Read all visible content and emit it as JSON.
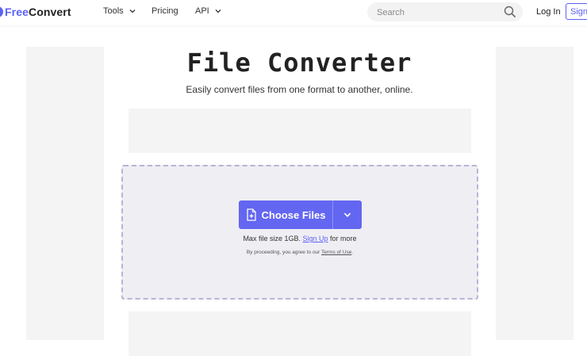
{
  "header": {
    "logo": {
      "part1": "Free",
      "part2": "Convert"
    },
    "nav": [
      {
        "label": "Tools",
        "has_dropdown": true
      },
      {
        "label": "Pricing",
        "has_dropdown": false
      },
      {
        "label": "API",
        "has_dropdown": true
      }
    ],
    "search": {
      "placeholder": "Search",
      "icon": "search-icon"
    },
    "login_label": "Log In",
    "signup_label": "Sign"
  },
  "main": {
    "title": "File Converter",
    "subtitle": "Easily convert files from one format to another, online.",
    "upload": {
      "button_label": "Choose Files",
      "button_icon": "file-plus-icon",
      "dropdown_icon": "chevron-down-icon",
      "max_size_prefix": "Max file size 1GB.",
      "signup_link": "Sign Up",
      "max_size_suffix": "for more",
      "terms_prefix": "By proceeding, you agree to our",
      "terms_link": "Terms of Use",
      "terms_suffix": "."
    }
  },
  "colors": {
    "accent": "#6366f1",
    "brand": "#5b61f6",
    "dropzone_bg": "#efeef3",
    "ad_bg": "#f4f4f4"
  }
}
